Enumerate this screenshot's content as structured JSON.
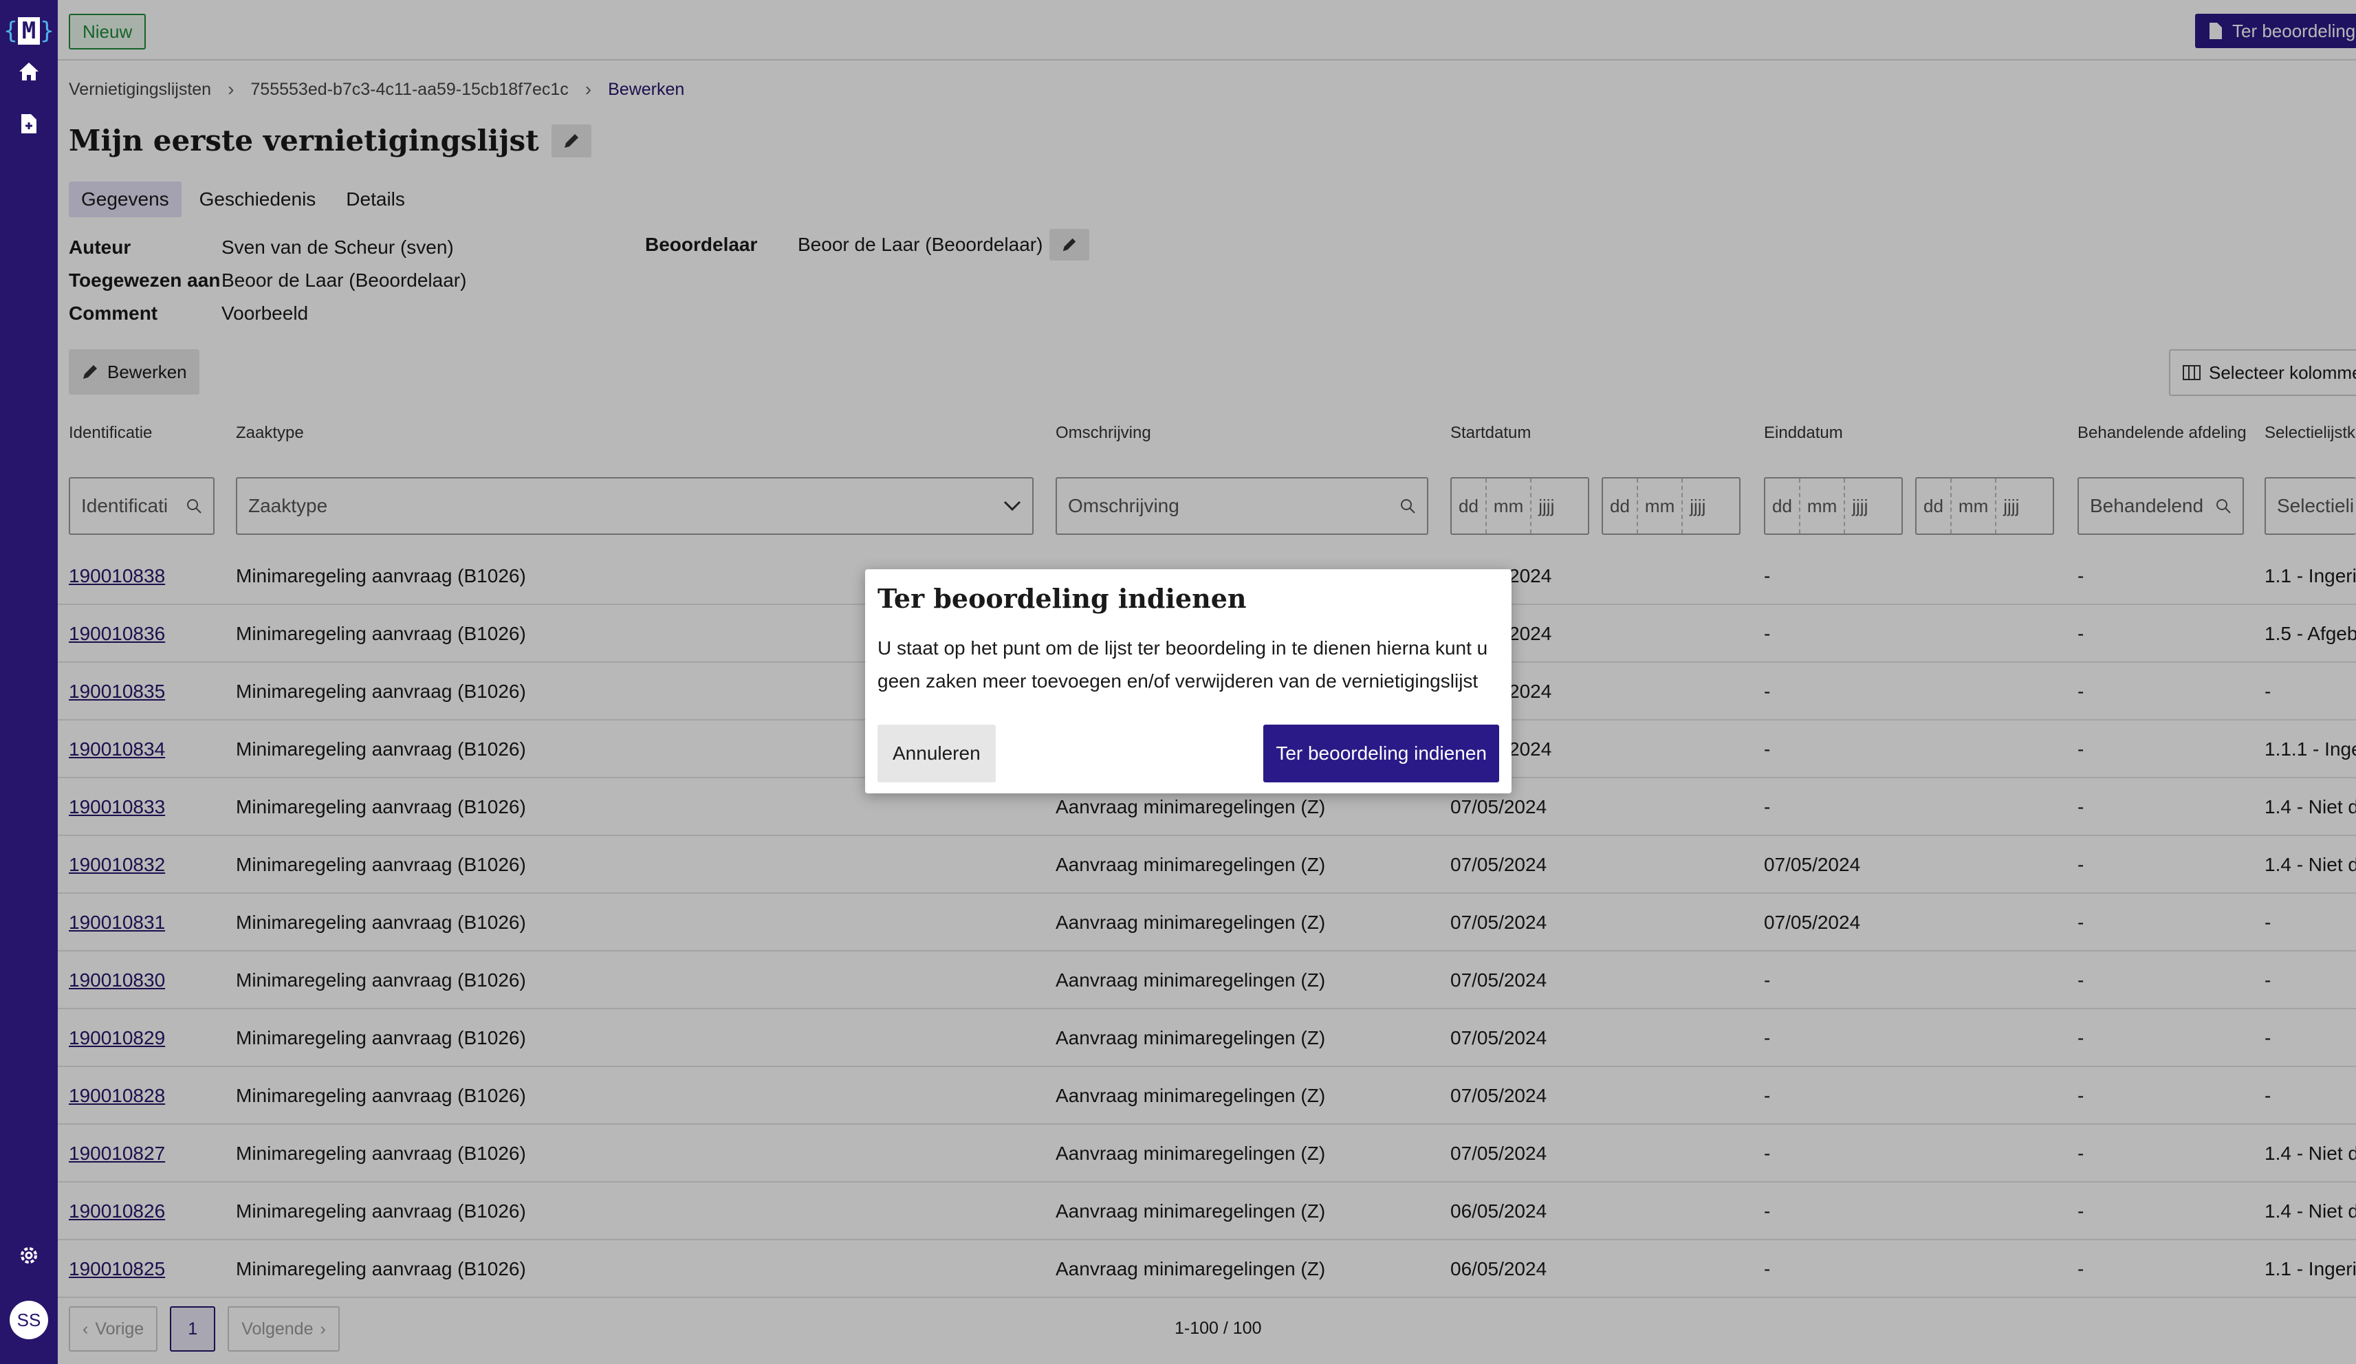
{
  "sidebar": {
    "logo": "M",
    "icons": [
      "home-icon",
      "document-add-icon",
      "gear-icon"
    ],
    "avatar": "SS"
  },
  "topbar": {
    "status_badge": "Nieuw",
    "submit_label": "Ter beoordeling indienen"
  },
  "breadcrumb": [
    "Vernietigingslijsten",
    "755553ed-b7c3-4c11-aa59-15cb18f7ec1c",
    "Bewerken"
  ],
  "title": "Mijn eerste vernietigingslijst",
  "tabs": [
    "Gegevens",
    "Geschiedenis",
    "Details"
  ],
  "properties": {
    "author_label": "Auteur",
    "author_value": "Sven van de Scheur (sven)",
    "assigned_label": "Toegewezen aan",
    "assigned_value": "Beoor de Laar (Beoordelaar)",
    "comment_label": "Comment",
    "comment_value": "Voorbeeld",
    "reviewer_label": "Beoordelaar",
    "reviewer_value": "Beoor de Laar (Beoordelaar)"
  },
  "actions": {
    "edit_label": "Bewerken",
    "select_columns_label": "Selecteer kolommen"
  },
  "table": {
    "columns": [
      "Identificatie",
      "Zaaktype",
      "Omschrijving",
      "Startdatum",
      "Einddatum",
      "Behandelende afdeling",
      "Selectielijstk"
    ],
    "filters": {
      "identificatie_placeholder": "Identificati",
      "zaaktype_placeholder": "Zaaktype",
      "omschrijving_placeholder": "Omschrijving",
      "afdeling_placeholder": "Behandelend",
      "selectielijst_placeholder": "Selectieli",
      "date_parts": [
        "dd",
        "mm",
        "jjjj"
      ]
    },
    "rows": [
      {
        "id": "190010838",
        "zaaktype": "Minimaregeling aanvraag (B1026)",
        "omschrijving": "",
        "start": "2024",
        "eind": "-",
        "afdeling": "-",
        "selectielijst": "1.1 - Ingeri"
      },
      {
        "id": "190010836",
        "zaaktype": "Minimaregeling aanvraag (B1026)",
        "omschrijving": "",
        "start": "2024",
        "eind": "-",
        "afdeling": "-",
        "selectielijst": "1.5 - Afgeb"
      },
      {
        "id": "190010835",
        "zaaktype": "Minimaregeling aanvraag (B1026)",
        "omschrijving": "",
        "start": "2024",
        "eind": "-",
        "afdeling": "-",
        "selectielijst": "-"
      },
      {
        "id": "190010834",
        "zaaktype": "Minimaregeling aanvraag (B1026)",
        "omschrijving": "",
        "start": "2024",
        "eind": "-",
        "afdeling": "-",
        "selectielijst": "1.1.1 - Inge"
      },
      {
        "id": "190010833",
        "zaaktype": "Minimaregeling aanvraag (B1026)",
        "omschrijving": "Aanvraag minimaregelingen (Z)",
        "start": "07/05/2024",
        "eind": "-",
        "afdeling": "-",
        "selectielijst": "1.4 - Niet d"
      },
      {
        "id": "190010832",
        "zaaktype": "Minimaregeling aanvraag (B1026)",
        "omschrijving": "Aanvraag minimaregelingen (Z)",
        "start": "07/05/2024",
        "eind": "07/05/2024",
        "afdeling": "-",
        "selectielijst": "1.4 - Niet d"
      },
      {
        "id": "190010831",
        "zaaktype": "Minimaregeling aanvraag (B1026)",
        "omschrijving": "Aanvraag minimaregelingen (Z)",
        "start": "07/05/2024",
        "eind": "07/05/2024",
        "afdeling": "-",
        "selectielijst": "-"
      },
      {
        "id": "190010830",
        "zaaktype": "Minimaregeling aanvraag (B1026)",
        "omschrijving": "Aanvraag minimaregelingen (Z)",
        "start": "07/05/2024",
        "eind": "-",
        "afdeling": "-",
        "selectielijst": "-"
      },
      {
        "id": "190010829",
        "zaaktype": "Minimaregeling aanvraag (B1026)",
        "omschrijving": "Aanvraag minimaregelingen (Z)",
        "start": "07/05/2024",
        "eind": "-",
        "afdeling": "-",
        "selectielijst": "-"
      },
      {
        "id": "190010828",
        "zaaktype": "Minimaregeling aanvraag (B1026)",
        "omschrijving": "Aanvraag minimaregelingen (Z)",
        "start": "07/05/2024",
        "eind": "-",
        "afdeling": "-",
        "selectielijst": "-"
      },
      {
        "id": "190010827",
        "zaaktype": "Minimaregeling aanvraag (B1026)",
        "omschrijving": "Aanvraag minimaregelingen (Z)",
        "start": "07/05/2024",
        "eind": "-",
        "afdeling": "-",
        "selectielijst": "1.4 - Niet d"
      },
      {
        "id": "190010826",
        "zaaktype": "Minimaregeling aanvraag (B1026)",
        "omschrijving": "Aanvraag minimaregelingen (Z)",
        "start": "06/05/2024",
        "eind": "-",
        "afdeling": "-",
        "selectielijst": "1.4 - Niet d"
      },
      {
        "id": "190010825",
        "zaaktype": "Minimaregeling aanvraag (B1026)",
        "omschrijving": "Aanvraag minimaregelingen (Z)",
        "start": "06/05/2024",
        "eind": "-",
        "afdeling": "-",
        "selectielijst": "1.1 - Ingeri"
      }
    ]
  },
  "pagination": {
    "prev_label": "Vorige",
    "current_page": "1",
    "next_label": "Volgende",
    "count": "1-100 / 100"
  },
  "modal": {
    "title": "Ter beoordeling indienen",
    "body": "U staat op het punt om de lijst ter beoordeling in te dienen hierna kunt u geen zaken meer toevoegen en/of verwijderen van de vernietigingslijst",
    "cancel_label": "Annuleren",
    "confirm_label": "Ter beoordeling indienen"
  },
  "colors": {
    "brand": "#27156b",
    "primary_button": "#2a1a87",
    "new_badge": "#1f8a3a"
  }
}
